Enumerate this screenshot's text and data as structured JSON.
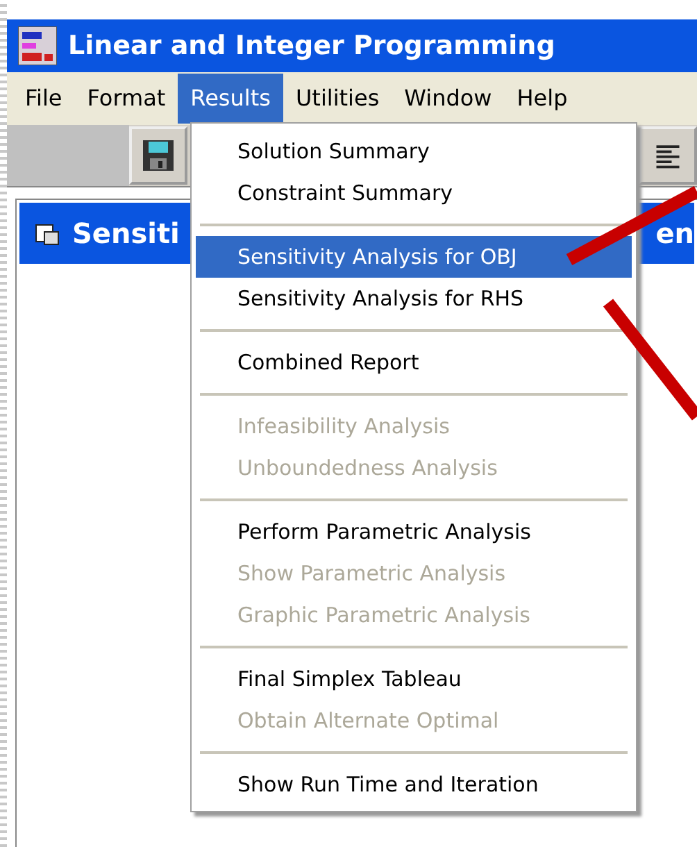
{
  "window": {
    "title": "Linear and Integer Programming"
  },
  "menu_bar": [
    {
      "label": "File",
      "selected": false
    },
    {
      "label": "Format",
      "selected": false
    },
    {
      "label": "Results",
      "selected": true
    },
    {
      "label": "Utilities",
      "selected": false
    },
    {
      "label": "Window",
      "selected": false
    },
    {
      "label": "Help",
      "selected": false
    }
  ],
  "results_menu": [
    {
      "kind": "item",
      "label": "Solution Summary",
      "selected": false,
      "disabled": false
    },
    {
      "kind": "item",
      "label": "Constraint Summary",
      "selected": false,
      "disabled": false
    },
    {
      "kind": "separator"
    },
    {
      "kind": "item",
      "label": "Sensitivity Analysis for OBJ",
      "selected": true,
      "disabled": false
    },
    {
      "kind": "item",
      "label": "Sensitivity Analysis for RHS",
      "selected": false,
      "disabled": false
    },
    {
      "kind": "separator"
    },
    {
      "kind": "item",
      "label": "Combined Report",
      "selected": false,
      "disabled": false
    },
    {
      "kind": "separator"
    },
    {
      "kind": "item",
      "label": "Infeasibility Analysis",
      "selected": false,
      "disabled": true
    },
    {
      "kind": "item",
      "label": "Unboundedness Analysis",
      "selected": false,
      "disabled": true
    },
    {
      "kind": "separator"
    },
    {
      "kind": "item",
      "label": "Perform Parametric Analysis",
      "selected": false,
      "disabled": false
    },
    {
      "kind": "item",
      "label": "Show Parametric Analysis",
      "selected": false,
      "disabled": true
    },
    {
      "kind": "item",
      "label": "Graphic Parametric Analysis",
      "selected": false,
      "disabled": true
    },
    {
      "kind": "separator"
    },
    {
      "kind": "item",
      "label": "Final Simplex Tableau",
      "selected": false,
      "disabled": false
    },
    {
      "kind": "item",
      "label": "Obtain Alternate Optimal",
      "selected": false,
      "disabled": true
    },
    {
      "kind": "separator"
    },
    {
      "kind": "item",
      "label": "Show Run Time and Iteration",
      "selected": false,
      "disabled": false
    }
  ],
  "child_window": {
    "title": "Sensiti",
    "title_right": "en"
  }
}
